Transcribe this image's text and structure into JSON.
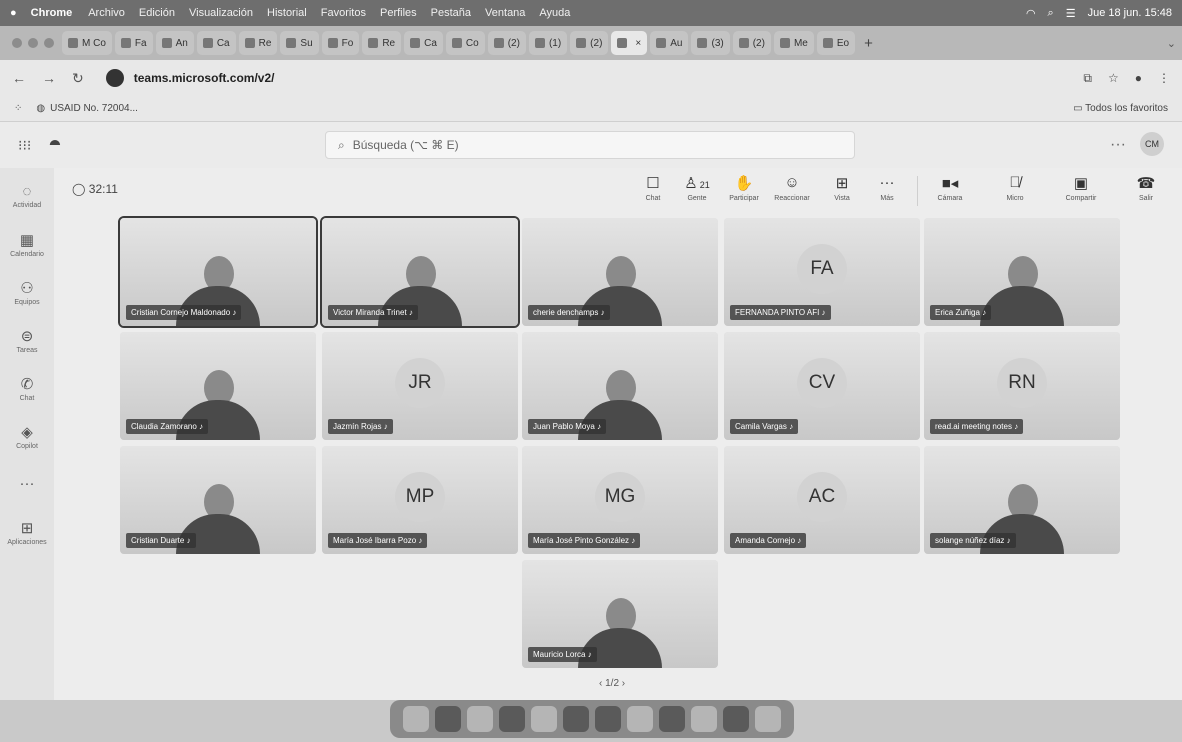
{
  "menubar": {
    "app": "Chrome",
    "items": [
      "Archivo",
      "Edición",
      "Visualización",
      "Historial",
      "Favoritos",
      "Perfiles",
      "Pestaña",
      "Ventana",
      "Ayuda"
    ],
    "datetime": "Jue 18 jun. 15:48"
  },
  "tabs": [
    {
      "label": "M Co"
    },
    {
      "label": "Fa"
    },
    {
      "label": "An"
    },
    {
      "label": "Ca"
    },
    {
      "label": "Re"
    },
    {
      "label": "Su"
    },
    {
      "label": "Fo"
    },
    {
      "label": "Re"
    },
    {
      "label": "Ca"
    },
    {
      "label": "Co"
    },
    {
      "label": "(2)"
    },
    {
      "label": "(1)"
    },
    {
      "label": "(2)"
    },
    {
      "label": "",
      "active": true
    },
    {
      "label": "Au"
    },
    {
      "label": "(3)"
    },
    {
      "label": "(2)"
    },
    {
      "label": "Me"
    },
    {
      "label": "Eo"
    }
  ],
  "address": {
    "url": "teams.microsoft.com/v2/"
  },
  "bookmarks": {
    "item": "USAID No. 72004...",
    "all": "Todos los favoritos"
  },
  "teams": {
    "search_placeholder": "Búsqueda (⌥ ⌘ E)",
    "avatar": "CM",
    "rail": [
      {
        "label": "Actividad",
        "icon": "bell-icon"
      },
      {
        "label": "Calendario",
        "icon": "calendar-icon"
      },
      {
        "label": "Equipos",
        "icon": "teams-icon"
      },
      {
        "label": "Tareas",
        "icon": "tasks-icon"
      },
      {
        "label": "Chat",
        "icon": "chat-icon"
      },
      {
        "label": "Copilot",
        "icon": "copilot-icon"
      },
      {
        "label": "...",
        "icon": "more-icon"
      },
      {
        "label": "Aplicaciones",
        "icon": "apps-icon"
      }
    ]
  },
  "meeting": {
    "timer": "32:11",
    "controls": {
      "chat": "Chat",
      "people": "Gente",
      "people_count": "21",
      "raise": "Participar",
      "react": "Reaccionar",
      "view": "Vista",
      "more": "Más",
      "camera": "Cámara",
      "mic": "Micro",
      "share": "Compartir",
      "leave": "Salir"
    },
    "participants": [
      {
        "name": "Cristian Cornejo Maldonado",
        "video": true,
        "highlight": true
      },
      {
        "name": "Victor Miranda Trinet",
        "video": true,
        "highlight": true
      },
      {
        "name": "cherie denchamps",
        "video": true
      },
      {
        "name": "FERNANDA PINTO AFI",
        "initials": "FA"
      },
      {
        "name": "Erica Zuñiga",
        "video": true
      },
      {
        "name": "Claudia Zamorano",
        "video": true
      },
      {
        "name": "Jazmín Rojas",
        "initials": "JR"
      },
      {
        "name": "Juan Pablo Moya",
        "video": true
      },
      {
        "name": "Camila Vargas",
        "initials": "CV"
      },
      {
        "name": "read.ai meeting notes",
        "initials": "RN"
      },
      {
        "name": "Cristian Duarte",
        "video": true
      },
      {
        "name": "María José Ibarra Pozo",
        "initials": "MP"
      },
      {
        "name": "María José Pinto González",
        "initials": "MG"
      },
      {
        "name": "Amanda Cornejo",
        "initials": "AC"
      },
      {
        "name": "solange núñez díaz",
        "video": true
      },
      {
        "name": "Mauricio Lorca",
        "video": true
      }
    ],
    "pager": "1/2"
  }
}
